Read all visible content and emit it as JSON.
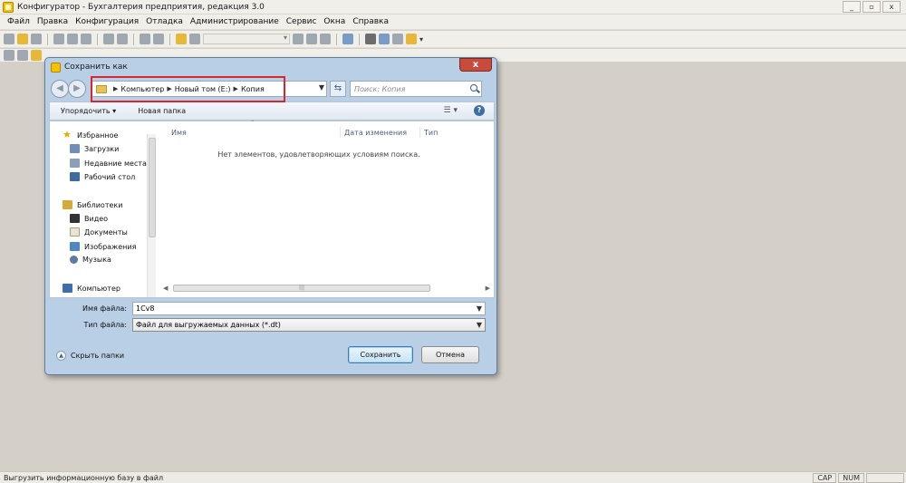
{
  "window": {
    "title": "Конфигуратор - Бухгалтерия предприятия, редакция 3.0",
    "controls": [
      "_",
      "▫",
      "x"
    ]
  },
  "menu": [
    {
      "label": "Файл"
    },
    {
      "label": "Правка"
    },
    {
      "label": "Конфигурация"
    },
    {
      "label": "Отладка"
    },
    {
      "label": "Администрирование"
    },
    {
      "label": "Сервис"
    },
    {
      "label": "Окна"
    },
    {
      "label": "Справка"
    }
  ],
  "dialog": {
    "title": "Сохранить как",
    "close_label": "x",
    "address": {
      "crumbs": [
        "Компьютер",
        "Новый том (E:)",
        "Копия"
      ]
    },
    "search_placeholder": "Поиск: Копия",
    "commands": {
      "organize": "Упорядочить ▾",
      "new_folder": "Новая папка"
    },
    "nav": {
      "favorites": "Избранное",
      "downloads": "Загрузки",
      "recent": "Недавние места",
      "desktop": "Рабочий стол",
      "libraries": "Библиотеки",
      "video": "Видео",
      "documents": "Документы",
      "images": "Изображения",
      "music": "Музыка",
      "computer": "Компьютер"
    },
    "columns": {
      "name": "Имя",
      "date_modified": "Дата изменения",
      "type": "Тип"
    },
    "empty_message": "Нет элементов, удовлетворяющих условиям поиска.",
    "filename_label": "Имя файла:",
    "filename_value": "1Cv8",
    "filetype_label": "Тип файла:",
    "filetype_value": "Файл для выгружаемых данных (*.dt)",
    "hide_folders": "Скрыть папки",
    "save_button": "Сохранить",
    "cancel_button": "Отмена"
  },
  "status": {
    "text": "Выгрузить информационную базу в файл",
    "cap": "CAP",
    "num": "NUM"
  }
}
